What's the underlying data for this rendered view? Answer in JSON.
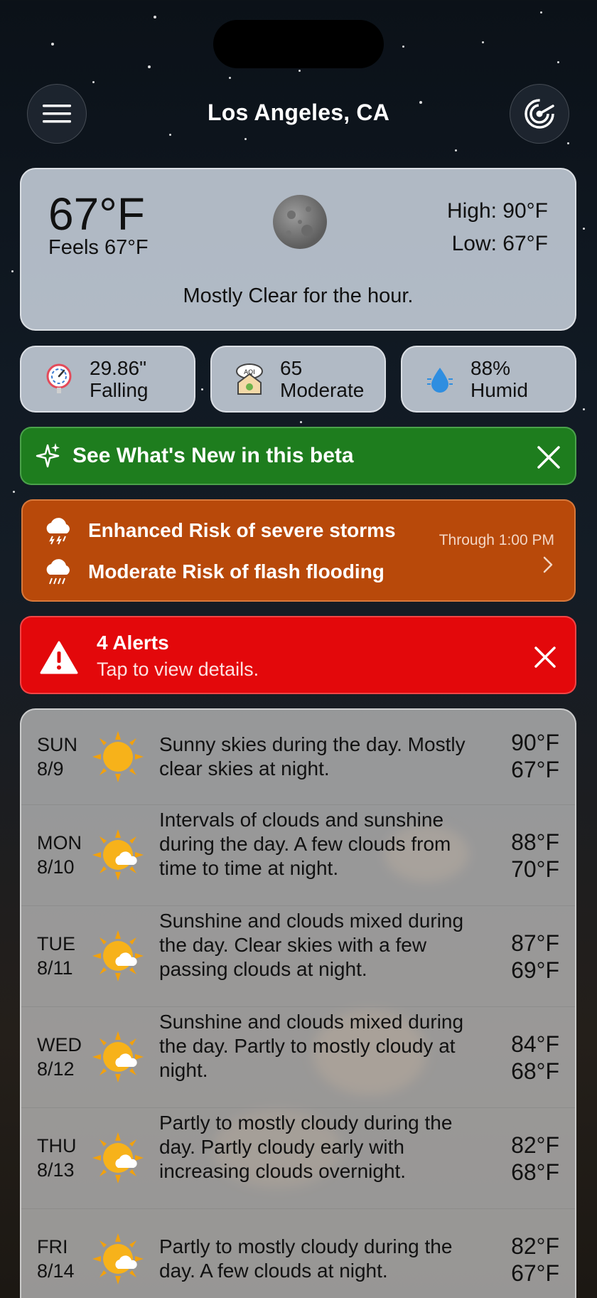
{
  "header": {
    "city": "Los Angeles, CA",
    "menu_icon": "hamburger-menu-icon",
    "radar_icon": "radar-icon"
  },
  "current": {
    "temp": "67°F",
    "feels": "Feels 67°F",
    "high": "High: 90°F",
    "low": "Low: 67°F",
    "summary": "Mostly Clear for the hour.",
    "condition_icon": "moon-icon"
  },
  "stats": [
    {
      "icon": "barometer-icon",
      "line1": "29.86\"",
      "line2": "Falling"
    },
    {
      "icon": "aqi-house-icon",
      "line1": "65",
      "line2": "Moderate"
    },
    {
      "icon": "water-drop-icon",
      "line1": "88%",
      "line2": "Humid"
    }
  ],
  "beta_banner": {
    "title": "See What's New in this beta",
    "color": "#1e7d1e"
  },
  "risk_banner": {
    "risk1": "Enhanced Risk of severe storms",
    "risk2": "Moderate Risk of flash flooding",
    "through": "Through 1:00 PM",
    "color": "#b8490a"
  },
  "alert_banner": {
    "title": "4 Alerts",
    "subtitle": "Tap to view details.",
    "color": "#e3080b"
  },
  "forecast": [
    {
      "dow": "SUN",
      "date": "8/9",
      "icon": "sun-icon",
      "desc": "Sunny skies during the day. Mostly clear skies at night.",
      "hi": "90°F",
      "lo": "67°F"
    },
    {
      "dow": "MON",
      "date": "8/10",
      "icon": "partly-sunny-icon",
      "desc": "Intervals of clouds and sunshine during the day. A few clouds from time to time at night.",
      "hi": "88°F",
      "lo": "70°F"
    },
    {
      "dow": "TUE",
      "date": "8/11",
      "icon": "partly-sunny-icon",
      "desc": "Sunshine and clouds mixed during the day. Clear skies with a few passing clouds at night.",
      "hi": "87°F",
      "lo": "69°F"
    },
    {
      "dow": "WED",
      "date": "8/12",
      "icon": "partly-sunny-icon",
      "desc": "Sunshine and clouds mixed during the day. Partly to mostly cloudy at night.",
      "hi": "84°F",
      "lo": "68°F"
    },
    {
      "dow": "THU",
      "date": "8/13",
      "icon": "partly-sunny-icon",
      "desc": "Partly to mostly cloudy during the day. Partly cloudy early with increasing clouds overnight.",
      "hi": "82°F",
      "lo": "68°F"
    },
    {
      "dow": "FRI",
      "date": "8/14",
      "icon": "partly-sunny-icon",
      "desc": "Partly to mostly cloudy during the day. A few clouds at night.",
      "hi": "82°F",
      "lo": "67°F"
    }
  ]
}
